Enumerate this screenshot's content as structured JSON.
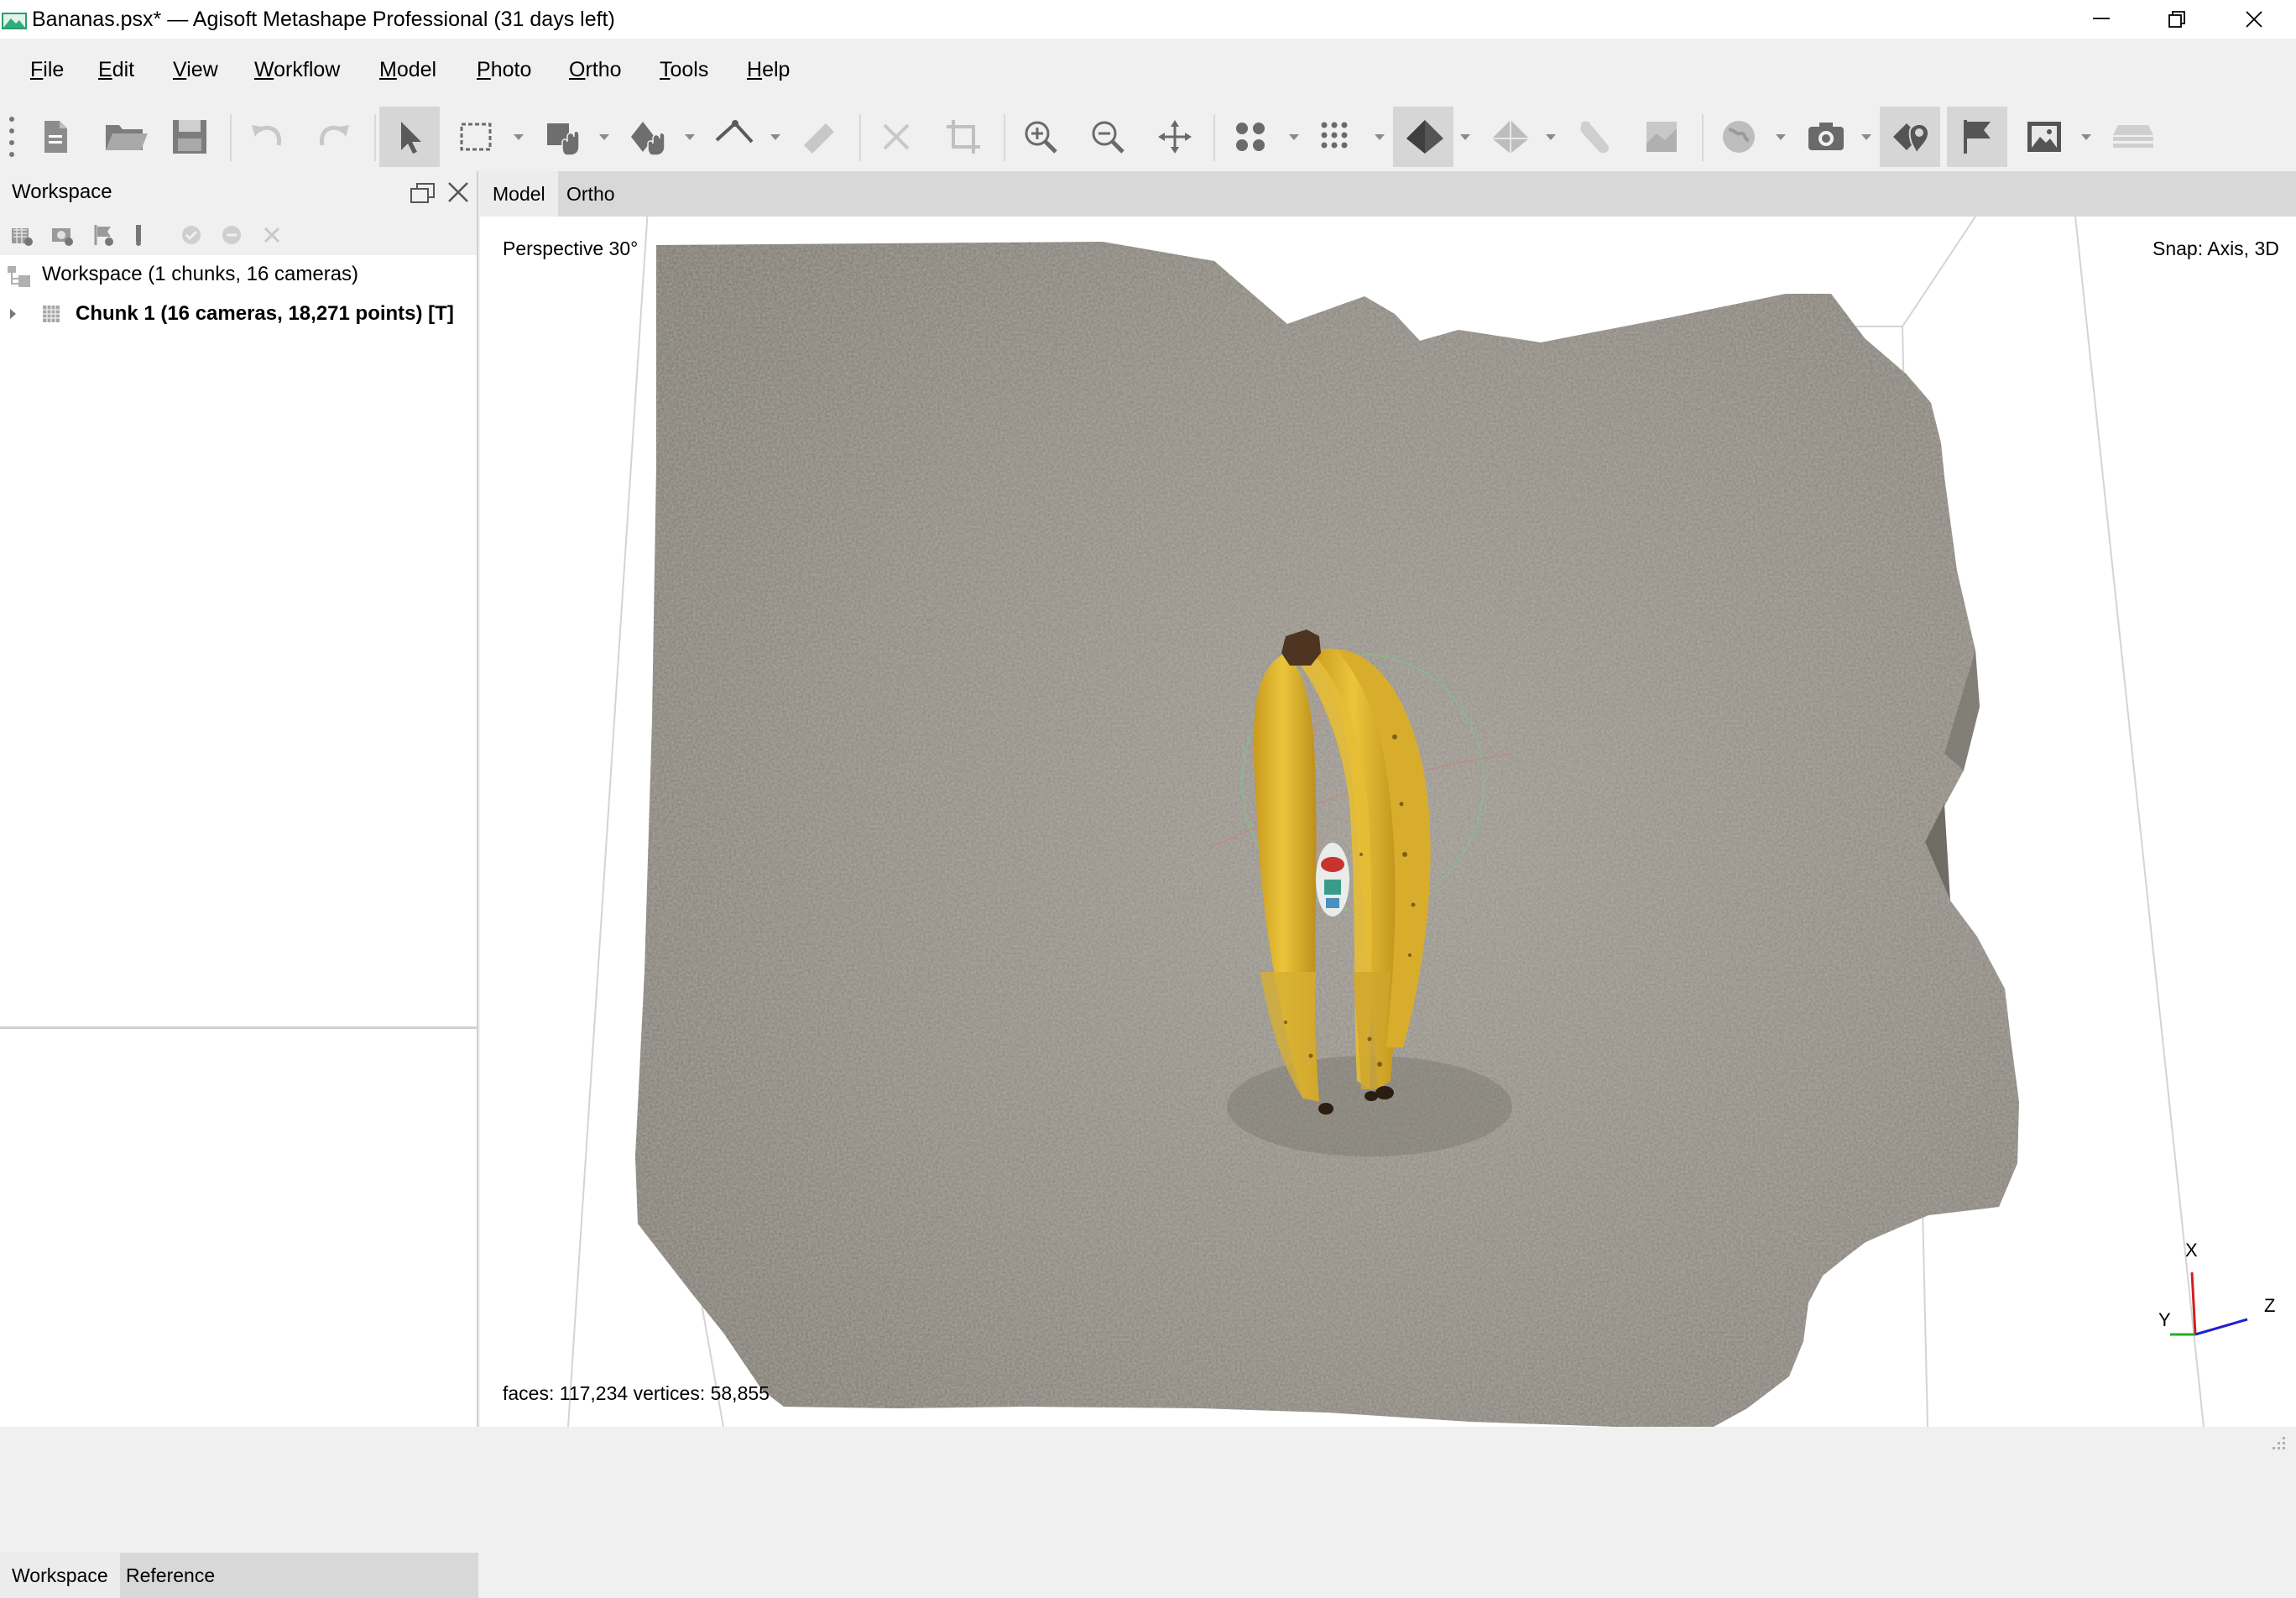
{
  "window": {
    "title": "Bananas.psx* — Agisoft Metashape Professional (31 days left)"
  },
  "menu": [
    {
      "accel": "F",
      "rest": "ile"
    },
    {
      "accel": "E",
      "rest": "dit"
    },
    {
      "accel": "V",
      "rest": "iew"
    },
    {
      "accel": "W",
      "rest": "orkflow"
    },
    {
      "accel": "M",
      "rest": "odel"
    },
    {
      "accel": "P",
      "rest": "hoto"
    },
    {
      "accel": "O",
      "rest": "rtho"
    },
    {
      "accel": "T",
      "rest": "ools"
    },
    {
      "accel": "H",
      "rest": "elp"
    }
  ],
  "workspace": {
    "title": "Workspace",
    "root_label": "Workspace (1 chunks, 16 cameras)",
    "chunk_label": "Chunk 1 (16 cameras, 18,271 points) [T]"
  },
  "left_tabs": [
    "Workspace",
    "Reference"
  ],
  "view_tabs": [
    "Model",
    "Ortho"
  ],
  "viewport": {
    "projection": "Perspective 30°",
    "snap": "Snap: Axis, 3D",
    "stats": "faces: 117,234 vertices: 58,855",
    "axis_labels": {
      "x": "X",
      "y": "Y",
      "z": "Z"
    }
  },
  "icons": {
    "toolbar": [
      "new-document-icon",
      "open-folder-icon",
      "save-icon",
      "undo-icon",
      "redo-icon",
      "select-pointer-icon",
      "rectangle-selection-icon",
      "move-object-icon",
      "rotate-object-icon",
      "ruler-icon",
      "measure-tool-icon",
      "delete-icon",
      "crop-icon",
      "zoom-in-icon",
      "zoom-out-icon",
      "reset-view-icon",
      "show-points-icon",
      "show-dense-cloud-icon",
      "show-model-icon",
      "show-tiled-model-icon",
      "show-texture-icon",
      "show-dem-icon",
      "show-region-icon",
      "show-cameras-icon",
      "show-markers-icon",
      "show-flags-icon",
      "show-images-icon",
      "show-layers-icon"
    ]
  },
  "colors": {
    "window_bg": "#f0f0f0",
    "active_toolbar_btn": "#d6d6d6",
    "banana_yellow": "#e2b931",
    "carpet_gray": "#8f8b83"
  }
}
